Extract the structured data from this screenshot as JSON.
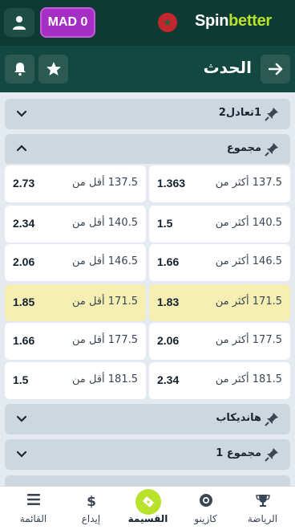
{
  "header": {
    "balance": "MAD 0",
    "logo_a": "Spin",
    "logo_b": "better"
  },
  "subheader": {
    "title": "الحدث"
  },
  "groups": [
    {
      "title": "1تعادل2",
      "expanded": false
    },
    {
      "title": "مجموع",
      "expanded": true
    },
    {
      "title": "هانديكاب",
      "expanded": false
    },
    {
      "title": "مجموع 1",
      "expanded": false
    }
  ],
  "markets": [
    {
      "over_label": "137.5 أكثر من",
      "over_odd": "1.363",
      "under_label": "137.5 أقل من",
      "under_odd": "2.73",
      "highlight": false
    },
    {
      "over_label": "140.5 أكثر من",
      "over_odd": "1.5",
      "under_label": "140.5 أقل من",
      "under_odd": "2.34",
      "highlight": false
    },
    {
      "over_label": "146.5 أكثر من",
      "over_odd": "1.66",
      "under_label": "146.5 أقل من",
      "under_odd": "2.06",
      "highlight": false
    },
    {
      "over_label": "171.5 أكثر من",
      "over_odd": "1.83",
      "under_label": "171.5 أقل من",
      "under_odd": "1.85",
      "highlight": true
    },
    {
      "over_label": "177.5 أكثر من",
      "over_odd": "2.06",
      "under_label": "177.5 أقل من",
      "under_odd": "1.66",
      "highlight": false
    },
    {
      "over_label": "181.5 أكثر من",
      "over_odd": "2.34",
      "under_label": "181.5 أقل من",
      "under_odd": "1.5",
      "highlight": false
    }
  ],
  "bottom_nav": [
    {
      "label": "الرياضة",
      "icon": "trophy-icon",
      "active": false
    },
    {
      "label": "كازينو",
      "icon": "casino-chip-icon",
      "active": false
    },
    {
      "label": "القسيمة",
      "icon": "coupon-icon",
      "active": true
    },
    {
      "label": "إيداع",
      "icon": "dollar-icon",
      "active": false
    },
    {
      "label": "القائمة",
      "icon": "menu-icon",
      "active": false
    }
  ],
  "colors": {
    "header_bg": "#0d3b33",
    "balance_bg": "#a52ec4",
    "accent": "#b8e22b",
    "highlight_row": "#f6efb3"
  }
}
